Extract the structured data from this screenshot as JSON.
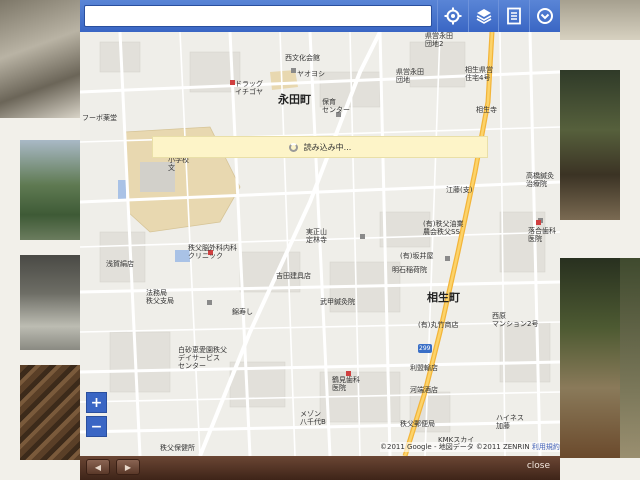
{
  "search": {
    "value": "",
    "placeholder": ""
  },
  "toolbar": {
    "icons": [
      "locate-icon",
      "layers-icon",
      "list-icon",
      "chevron-down-circle-icon"
    ]
  },
  "map": {
    "loading_text": "読み込み中...",
    "districts": {
      "nagata": "永田町",
      "aioi": "相生町"
    },
    "labels": {
      "nishi_bunka": "西文化会館",
      "yaoyoshi": "ヤオヨシ",
      "drug_ichigoya": "ドラッグ\nイチゴヤ",
      "hoiku": "保育\nセンター",
      "kenei_nagata": "県営永田\n団地2",
      "kenei_nagata_b": "県営永田\n団地",
      "aioi_kenei": "相生県営\n住宅4号",
      "aioi_ji": "相生寺",
      "elementary": "小学校\n文",
      "chichibu_clinic": "秩父脳外科内科\nクリニック",
      "asamiya": "浅賀絹店",
      "court": "法務局\n秩父支局",
      "takashina": "高橋鍼灸\n治療院",
      "fuji_takada": "(有)秩父油業\n農会秩父SS",
      "aioi_dental": "落合歯科\n医院",
      "yamazaki": "(有)坂井屋",
      "meisei": "明石稲荷院",
      "yoshida": "吉田建具店",
      "takeda": "武甲鍼灸院",
      "takeshi": "(有)丸竹商店",
      "shimizu": "西原\nマンション2号",
      "nishi_hide": "錦寿し",
      "day_service": "白砂恵愛園秩父\nデイサービス\nセンター",
      "hokuro": "鶴見歯科\n医院",
      "hachino": "利盟輸店",
      "meison": "メゾン\n八千代B",
      "kawai": "河端酒店",
      "chichibu_post": "秩父郵便局",
      "kmk": "KMKスカイ",
      "heiwa": "ハイネス\n加藤",
      "jinja": "実正山\n定林寺",
      "hashiba": "秩父保健所",
      "eishou": "フーボ薬堂",
      "touan": "江藤(支)"
    },
    "route_badge": "299",
    "copyright": "©2011 Google - 地図データ ©2011 ZENRIN",
    "terms": "利用規約"
  },
  "controls": {
    "zoom_in": "+",
    "zoom_out": "−"
  },
  "bottom": {
    "prev": "◀",
    "next": "▶",
    "close": "close"
  }
}
